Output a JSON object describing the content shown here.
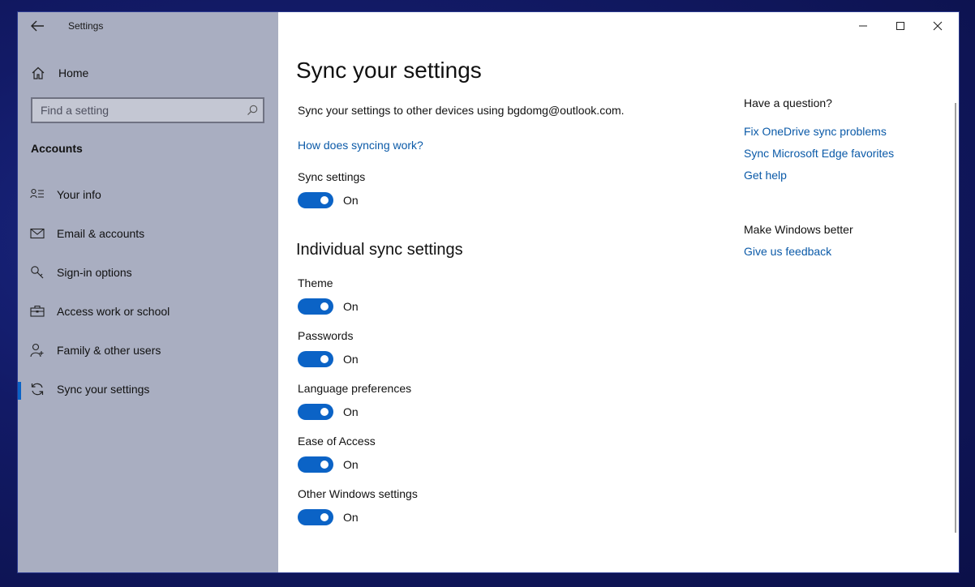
{
  "window": {
    "title": "Settings"
  },
  "sidebar": {
    "home_label": "Home",
    "search_placeholder": "Find a setting",
    "section_heading": "Accounts",
    "items": [
      {
        "label": "Your info",
        "icon": "person-card-icon",
        "active": false
      },
      {
        "label": "Email & accounts",
        "icon": "mail-icon",
        "active": false
      },
      {
        "label": "Sign-in options",
        "icon": "key-icon",
        "active": false
      },
      {
        "label": "Access work or school",
        "icon": "briefcase-icon",
        "active": false
      },
      {
        "label": "Family & other users",
        "icon": "person-add-icon",
        "active": false
      },
      {
        "label": "Sync your settings",
        "icon": "sync-icon",
        "active": true
      }
    ]
  },
  "main": {
    "title": "Sync your settings",
    "description": "Sync your settings to other devices using bgdomg@outlook.com.",
    "how_link": "How does syncing work?",
    "sync_settings": {
      "label": "Sync settings",
      "state": "On"
    },
    "individual_heading": "Individual sync settings",
    "individual": [
      {
        "label": "Theme",
        "state": "On"
      },
      {
        "label": "Passwords",
        "state": "On"
      },
      {
        "label": "Language preferences",
        "state": "On"
      },
      {
        "label": "Ease of Access",
        "state": "On"
      },
      {
        "label": "Other Windows settings",
        "state": "On"
      }
    ]
  },
  "help_panel": {
    "question_title": "Have a question?",
    "links": [
      "Fix OneDrive sync problems",
      "Sync Microsoft Edge favorites",
      "Get help"
    ],
    "better_title": "Make Windows better",
    "feedback_link": "Give us feedback"
  },
  "colors": {
    "accent": "#0b63c6",
    "link": "#0b5aa8",
    "sidebar_bg": "#a9aec1",
    "desktop_bg": "#121a66"
  }
}
